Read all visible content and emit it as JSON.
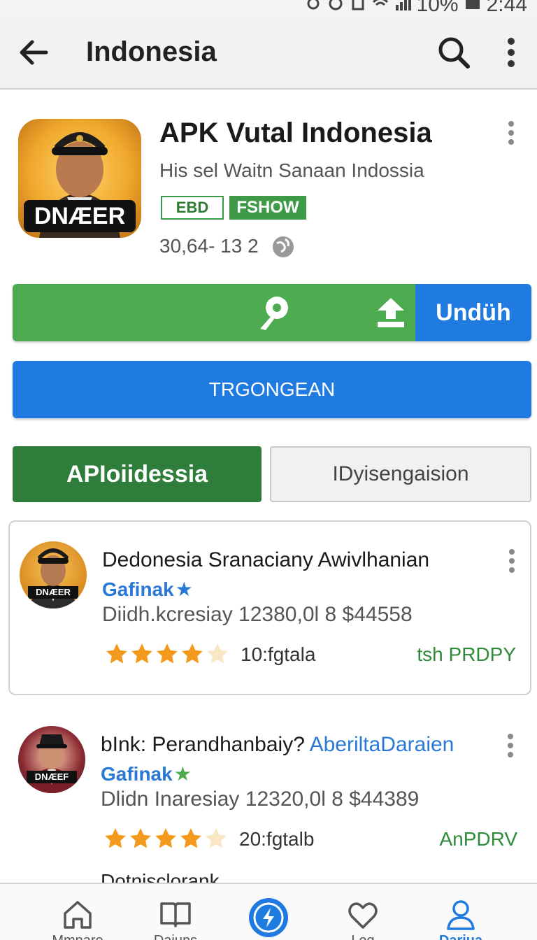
{
  "status_bar": {
    "battery": "10%",
    "time": "2:44"
  },
  "app_bar": {
    "title": "Indonesia"
  },
  "app": {
    "name": "APK Vutal Indonesia",
    "subtitle": "His sel Waitn Sanaan Indossia",
    "icon_label": "DNÆER",
    "badge_outline": "EBD",
    "badge_fill": "FSHOW",
    "meta": "30,64- 13 2"
  },
  "actions": {
    "download_label": "Undüh",
    "primary_label": "TRGONGEAN"
  },
  "tabs": [
    {
      "label": "APIoiidessia",
      "active": true
    },
    {
      "label": "IDyisengaision",
      "active": false
    }
  ],
  "items": [
    {
      "title": "Dedonesia Sranaciany Awivlhanian",
      "title_link": "",
      "author": "Gafinak",
      "description": "Diidh.kcresiay 12380,0l 8 $44558",
      "rating": 4.5,
      "rating_text": "10:fgtala",
      "tag": "tsh PRDPY",
      "avatar_label": "DNÆER",
      "star_color": "#2a78d6"
    },
    {
      "title": "bInk: Perandhanbaiy?",
      "title_link": "AberiltaDaraien",
      "author": "Gafinak",
      "description": "Dlidn Inaresiay 12320,0l 8 $44389",
      "rating": 4.5,
      "rating_text": "20:fgtalb",
      "tag": "AnPDRV",
      "avatar_label": "DNÆEF",
      "star_color": "#4caa4f"
    }
  ],
  "peek": {
    "title": "Dotnisclorank"
  },
  "bottom_nav": [
    {
      "label": "Mmnare",
      "icon": "home-icon",
      "active": false
    },
    {
      "label": "Daiuns",
      "icon": "book-icon",
      "active": false
    },
    {
      "label": "Log",
      "icon": "heart-icon",
      "active": false
    },
    {
      "label": "Dariua",
      "icon": "person-icon",
      "active": true
    }
  ],
  "colors": {
    "green": "#4caa4f",
    "dark_green": "#2e7d3a",
    "blue": "#1f7be0",
    "star": "#f39a1c"
  }
}
